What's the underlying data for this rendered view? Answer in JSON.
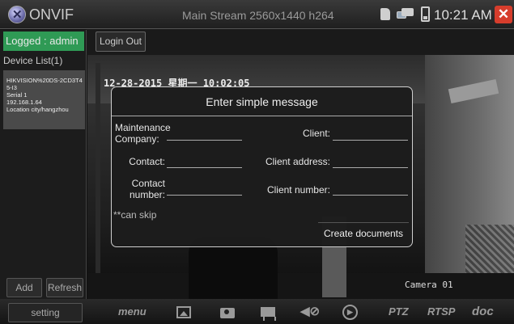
{
  "header": {
    "app_title": "ONVIF",
    "stream_info": "Main Stream 2560x1440 h264",
    "clock": "10:21 AM",
    "close_symbol": "✕",
    "icons": [
      "sd-card-icon",
      "network-icon",
      "battery-icon"
    ]
  },
  "sidebar": {
    "logged": "Logged : admin",
    "device_list_label": "Device List(1)",
    "device": {
      "name": "HIKVISION%20DS-2CD3T45-I3",
      "serial": "Serial  1",
      "ip": "192.168.1.64",
      "location": "Location city/hangzhou"
    },
    "add_label": "Add",
    "refresh_label": "Refresh"
  },
  "toolbar": {
    "login_out_label": "Login Out"
  },
  "video": {
    "osd_date": "12-28-2015 星期一 10:02:05",
    "osd_camera": "Camera 01"
  },
  "dialog": {
    "title": "Enter simple message",
    "fields": {
      "maintenance_company_label": "Maintenance Company:",
      "client_label": "Client:",
      "contact_label": "Contact:",
      "client_address_label": "Client address:",
      "contact_number_label": "Contact number:",
      "client_number_label": "Client number:"
    },
    "skip_note": "**can skip",
    "create_label": "Create documents"
  },
  "bottombar": {
    "setting_label": "setting",
    "menu_label": "menu",
    "ptz_label": "PTZ",
    "rtsp_label": "RTSP",
    "doc_label": "doc",
    "mute_symbol": "◀⊘",
    "play_symbol": "▶"
  },
  "colors": {
    "logged_bg": "#2f9a55",
    "close_bg": "#d63d2c",
    "dialog_bg": "#1c1c1c"
  }
}
